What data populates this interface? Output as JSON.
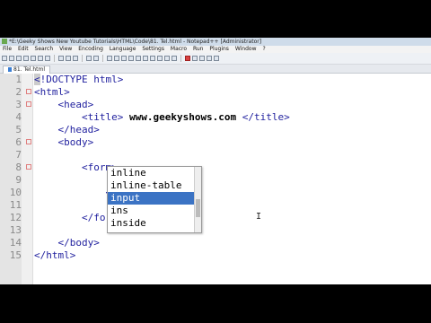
{
  "window": {
    "title": "*E:\\Geeky Shows New Youtube Tutorials\\HTML\\Code\\81. Tel.html - Notepad++ [Administrator]"
  },
  "menu": [
    "File",
    "Edit",
    "Search",
    "View",
    "Encoding",
    "Language",
    "Settings",
    "Macro",
    "Run",
    "Plugins",
    "Window",
    "?"
  ],
  "tab": {
    "label": "81. Tel.html"
  },
  "editor": {
    "lines": [
      {
        "num": "1",
        "text": "<!DOCTYPE html>"
      },
      {
        "num": "2",
        "text": "<html>"
      },
      {
        "num": "3",
        "text": "    <head>"
      },
      {
        "num": "4",
        "pre": "        <title> ",
        "bold": "www.geekyshows.com",
        "post": " </title>"
      },
      {
        "num": "5",
        "text": "    </head>"
      },
      {
        "num": "6",
        "text": "    <body>"
      },
      {
        "num": "7",
        "text": ""
      },
      {
        "num": "8",
        "text": "        <form>"
      },
      {
        "num": "9",
        "text": ""
      },
      {
        "num": "10",
        "text": "            <input"
      },
      {
        "num": "11",
        "text": ""
      },
      {
        "num": "12",
        "text": "        </fo"
      },
      {
        "num": "13",
        "text": ""
      },
      {
        "num": "14",
        "text": "    </body>"
      },
      {
        "num": "15",
        "text": "</html>"
      }
    ]
  },
  "autocomplete": {
    "items": [
      "inline",
      "inline-table",
      "input",
      "ins",
      "inside"
    ],
    "selected": "input"
  }
}
